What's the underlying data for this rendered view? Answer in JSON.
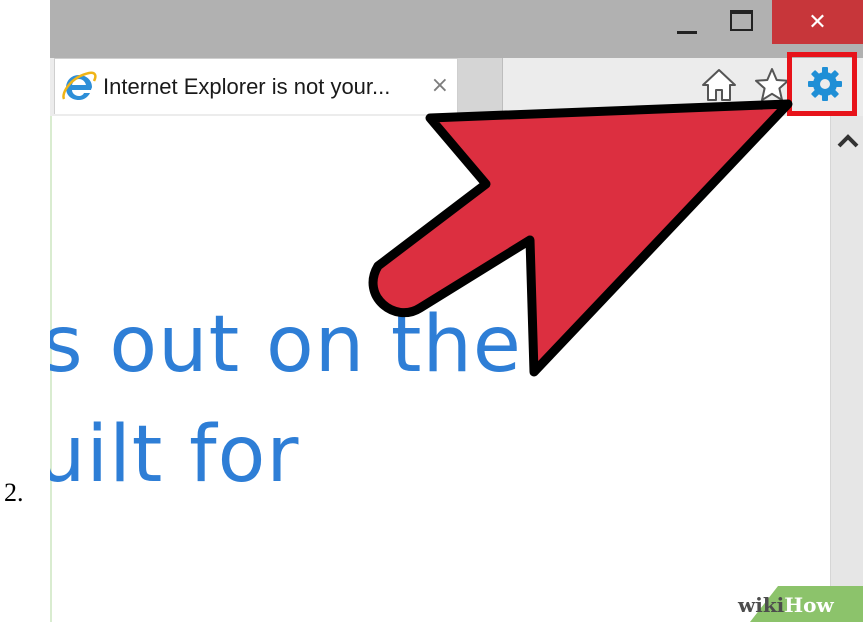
{
  "step": {
    "number": "2."
  },
  "browser": {
    "window_controls": {
      "minimize": "minimize",
      "maximize": "maximize",
      "close_glyph": "✕"
    },
    "tab": {
      "title": "Internet Explorer is not your...",
      "close_glyph": "×",
      "icon": "ie-logo-icon"
    },
    "toolbar_icons": [
      "home-icon",
      "star-icon",
      "gear-icon"
    ],
    "page": {
      "hero_lines": [
        "s out on the",
        "uilt for"
      ]
    },
    "scrollbar": {
      "up_glyph": "chevron-up-icon"
    }
  },
  "annotation": {
    "arrow_color": "#dc2f40",
    "highlight_color": "#e7131a"
  },
  "watermark": {
    "prefix": "wiki",
    "suffix": "How"
  },
  "colors": {
    "titlebar": "#b1b1b1",
    "close_button": "#c7363a",
    "hero_text": "#2e7ed6",
    "gear": "#1f8fd6"
  }
}
